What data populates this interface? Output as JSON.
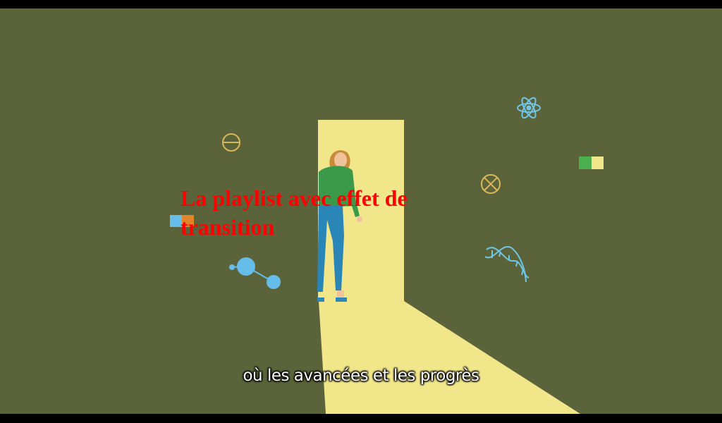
{
  "video": {
    "overlay_title": "La playlist avec effet de transition",
    "subtitle": "où les avancées et les progrès"
  },
  "colors": {
    "background": "#5b633a",
    "door_light": "#f1e78a",
    "overlay_text": "#ff0000",
    "shirt": "#3a9a4a",
    "pants": "#2b86b8",
    "hair": "#c98a3a",
    "accent_blue": "#66bde9",
    "accent_gold": "#d8b85a",
    "accent_green": "#4caf50",
    "accent_orange": "#e2852a"
  },
  "icons": [
    "theta-circle-icon",
    "molecule-icon",
    "blue-orange-block-icon",
    "atom-icon",
    "green-yellow-block-icon",
    "crossed-circle-icon",
    "dna-helix-icon"
  ]
}
